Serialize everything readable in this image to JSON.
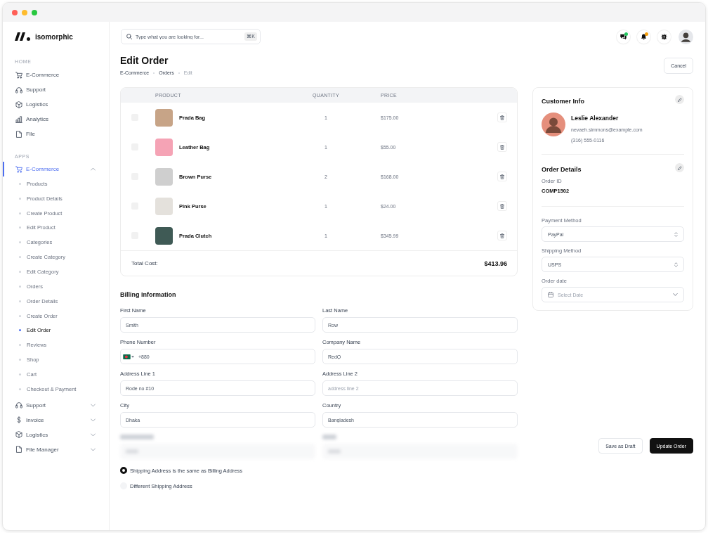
{
  "window": {
    "controls": [
      {
        "color": "#ff5f57"
      },
      {
        "color": "#febc2e"
      },
      {
        "color": "#28c840"
      }
    ]
  },
  "sidebar": {
    "logo": "isomorphic",
    "sections": [
      {
        "title": "HOME",
        "items": [
          {
            "label": "E-Commerce",
            "selected": false
          },
          {
            "label": "Support",
            "selected": false
          },
          {
            "label": "Logistics",
            "selected": false
          },
          {
            "label": "Analytics",
            "selected": false
          },
          {
            "label": "File",
            "selected": false
          }
        ]
      },
      {
        "title": "APPS",
        "items": [
          {
            "label": "E-Commerce",
            "selected": true,
            "expanded": true,
            "children": [
              {
                "label": "Products",
                "selected": false
              },
              {
                "label": "Product Details",
                "selected": false
              },
              {
                "label": "Create Product",
                "selected": false
              },
              {
                "label": "Edit Product",
                "selected": false
              },
              {
                "label": "Categories",
                "selected": false
              },
              {
                "label": "Create Category",
                "selected": false
              },
              {
                "label": "Edit Category",
                "selected": false
              },
              {
                "label": "Orders",
                "selected": false
              },
              {
                "label": "Order Details",
                "selected": false
              },
              {
                "label": "Create Order",
                "selected": false
              },
              {
                "label": "Edit Order",
                "selected": true
              },
              {
                "label": "Reviews",
                "selected": false
              },
              {
                "label": "Shop",
                "selected": false
              },
              {
                "label": "Cart",
                "selected": false
              },
              {
                "label": "Checkout & Payment",
                "selected": false
              }
            ]
          },
          {
            "label": "Support",
            "selected": false,
            "expanded": false
          },
          {
            "label": "Invoice",
            "selected": false,
            "expanded": false
          },
          {
            "label": "Logistics",
            "selected": false,
            "expanded": false
          },
          {
            "label": "File Manager",
            "selected": false,
            "expanded": false
          }
        ]
      }
    ]
  },
  "header": {
    "search": {
      "placeholder": "Type what you are looking for...",
      "shortcut": "⌘K"
    },
    "actions": [
      {
        "unread": true,
        "color": "#22c55e"
      },
      {
        "unread": true,
        "color": "#f59e0b"
      },
      {
        "unread": false
      }
    ]
  },
  "page": {
    "title": "Edit Order",
    "breadcrumb": [
      {
        "label": "E-Commerce",
        "current": false
      },
      {
        "label": "Orders",
        "current": false
      },
      {
        "label": "Edit",
        "current": true
      }
    ],
    "cancel": "Cancel"
  },
  "order_table": {
    "columns": [
      "PRODUCT",
      "QUANTITY",
      "PRICE"
    ],
    "rows": [
      {
        "name": "Prada Bag",
        "quantity": "1",
        "price": "$175.00",
        "checked": false
      },
      {
        "name": "Leather Bag",
        "quantity": "1",
        "price": "$55.00",
        "checked": false
      },
      {
        "name": "Brown Purse",
        "quantity": "2",
        "price": "$168.00",
        "checked": false
      },
      {
        "name": "Pink Purse",
        "quantity": "1",
        "price": "$24.00",
        "checked": false
      },
      {
        "name": "Prada Clutch",
        "quantity": "1",
        "price": "$345.99",
        "checked": false
      }
    ],
    "total_label": "Total Cost:",
    "total": "$413.96"
  },
  "billing": {
    "title": "Billing Information",
    "fields": [
      {
        "kind": "text",
        "label": "First Name",
        "value": "Smith"
      },
      {
        "kind": "text",
        "label": "Last Name",
        "value": "Row"
      },
      {
        "kind": "phone",
        "label": "Phone Number",
        "value": "+880"
      },
      {
        "kind": "text",
        "label": "Company Name",
        "value": "RedQ"
      },
      {
        "kind": "text",
        "label": "Address Line 1",
        "value": "Rode no #10"
      },
      {
        "kind": "text",
        "label": "Address Line 2",
        "placeholder": "address line 2"
      },
      {
        "kind": "text",
        "label": "City",
        "value": "Dhaka"
      },
      {
        "kind": "text",
        "label": "Country",
        "value": "Bangladesh"
      }
    ]
  },
  "shipping_options": [
    {
      "label": "Shipping Address is the same as Billing Address",
      "selected": true
    },
    {
      "label": "Different Shipping Address",
      "selected": false
    }
  ],
  "customer": {
    "title": "Customer Info",
    "name": "Leslie Alexander",
    "email": "nevaeh.simmons@example.com",
    "phone": "(316) 555-0116"
  },
  "order_details": {
    "title": "Order Details",
    "id_label": "Order ID",
    "order_id": "COMP1502",
    "fields": [
      {
        "kind": "select",
        "label": "Payment Method",
        "value": "PayPal"
      },
      {
        "kind": "select",
        "label": "Shipping Method",
        "value": "USPS"
      },
      {
        "kind": "date",
        "label": "Order date",
        "placeholder": "Select Date"
      }
    ]
  },
  "actions": [
    {
      "kind": "secondary",
      "label": "Save as Draft"
    },
    {
      "kind": "primary",
      "label": "Update Order"
    }
  ]
}
